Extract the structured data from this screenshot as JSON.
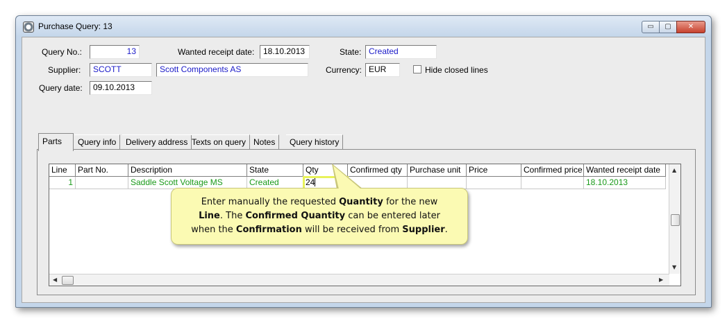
{
  "window": {
    "title": "Purchase Query: 13",
    "buttons": {
      "minimize": "▭",
      "maximize": "▢",
      "close": "✕"
    }
  },
  "header": {
    "query_no_label": "Query No.:",
    "query_no_value": "13",
    "wanted_receipt_label": "Wanted receipt date:",
    "wanted_receipt_value": "18.10.2013",
    "state_label": "State:",
    "state_value": "Created",
    "supplier_label": "Supplier:",
    "supplier_code": "SCOTT",
    "supplier_name": "Scott Components AS",
    "currency_label": "Currency:",
    "currency_value": "EUR",
    "hide_closed_label": "Hide closed lines",
    "hide_closed_checked": false,
    "query_date_label": "Query date:",
    "query_date_value": "09.10.2013"
  },
  "tabs": [
    "Parts",
    "Query info",
    "Delivery address",
    "Texts on query",
    "Notes",
    "Query history"
  ],
  "grid": {
    "columns": [
      "Line",
      "Part No.",
      "Description",
      "State",
      "Qty",
      "Confirmed qty",
      "Purchase unit",
      "Price",
      "Confirmed price",
      "Wanted receipt date"
    ],
    "rows": [
      {
        "line": "1",
        "part_no": "",
        "description": "Saddle Scott Voltage MS",
        "state": "Created",
        "qty": "24",
        "confirmed_qty": "",
        "purchase_unit": "",
        "price": "",
        "confirmed_price": "",
        "wanted_receipt_date": "18.10.2013"
      }
    ]
  },
  "callout": {
    "line1_a": "Enter manually the requested ",
    "line1_b": "Quantity",
    "line1_c": " for the new",
    "line2_a": "Line",
    "line2_b": ".  The ",
    "line2_c": "Confirmed Quantity",
    "line2_d": " can be entered later",
    "line3_a": "when the ",
    "line3_b": "Confirmation",
    "line3_c": " will be received from ",
    "line3_d": "Supplier",
    "line3_e": "."
  },
  "colors": {
    "link_blue": "#1a1ac8",
    "row_green": "#1a9a1a",
    "highlight_yellow": "#e8f25a",
    "callout_bg": "#fbfab3"
  }
}
